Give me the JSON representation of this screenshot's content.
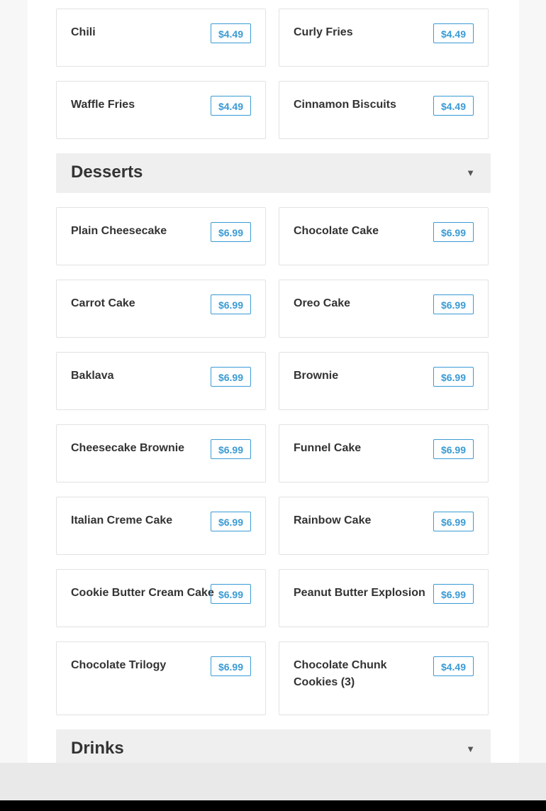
{
  "sides": {
    "items": [
      {
        "name": "Chili",
        "price": "$4.49"
      },
      {
        "name": "Curly Fries",
        "price": "$4.49"
      },
      {
        "name": "Waffle Fries",
        "price": "$4.49"
      },
      {
        "name": "Cinnamon Biscuits",
        "price": "$4.49"
      }
    ]
  },
  "desserts": {
    "title": "Desserts",
    "chevron": "▼",
    "items": [
      {
        "name": "Plain Cheesecake",
        "price": "$6.99"
      },
      {
        "name": "Chocolate Cake",
        "price": "$6.99"
      },
      {
        "name": "Carrot Cake",
        "price": "$6.99"
      },
      {
        "name": "Oreo Cake",
        "price": "$6.99"
      },
      {
        "name": "Baklava",
        "price": "$6.99"
      },
      {
        "name": "Brownie",
        "price": "$6.99"
      },
      {
        "name": "Cheesecake Brownie",
        "price": "$6.99"
      },
      {
        "name": "Funnel Cake",
        "price": "$6.99"
      },
      {
        "name": "Italian Creme Cake",
        "price": "$6.99"
      },
      {
        "name": "Rainbow Cake",
        "price": "$6.99"
      },
      {
        "name": "Cookie Butter Cream Cake",
        "price": "$6.99"
      },
      {
        "name": "Peanut Butter Explosion",
        "price": "$6.99"
      },
      {
        "name": "Chocolate Trilogy",
        "price": "$6.99"
      },
      {
        "name": "Chocolate Chunk Cookies (3)",
        "price": "$4.49"
      }
    ]
  },
  "drinks": {
    "title": "Drinks",
    "chevron": "▼"
  },
  "colors": {
    "accent": "#3a9bd5",
    "header_bg": "#efefef",
    "text": "#333333"
  }
}
